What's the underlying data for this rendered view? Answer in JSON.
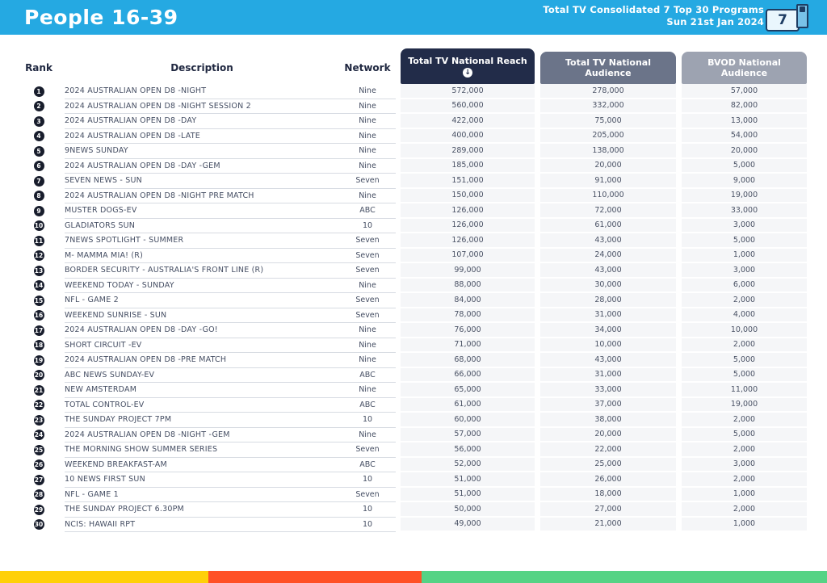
{
  "header": {
    "title": "People 16-39",
    "subtitle_line1": "Total TV Consolidated 7 Top 30 Programs",
    "subtitle_line2": "Sun 21st Jan 2024",
    "logo_number": "7",
    "background_color": "#25A9E2"
  },
  "table": {
    "columns": {
      "rank": "Rank",
      "description": "Description",
      "network": "Network",
      "reach": "Total TV National Reach",
      "audience": "Total TV National Audience",
      "bvod": "BVOD National Audience"
    },
    "header_colors": {
      "reach": "#222C49",
      "audience": "#6B7489",
      "bvod": "#9DA3B1"
    },
    "icons": {
      "sort_descending": "↓"
    },
    "rows": [
      {
        "rank": "1",
        "description": "2024 AUSTRALIAN OPEN D8 -NIGHT",
        "network": "Nine",
        "reach": "572,000",
        "audience": "278,000",
        "bvod": "57,000"
      },
      {
        "rank": "2",
        "description": "2024 AUSTRALIAN OPEN D8 -NIGHT SESSION 2",
        "network": "Nine",
        "reach": "560,000",
        "audience": "332,000",
        "bvod": "82,000"
      },
      {
        "rank": "3",
        "description": "2024 AUSTRALIAN OPEN D8 -DAY",
        "network": "Nine",
        "reach": "422,000",
        "audience": "75,000",
        "bvod": "13,000"
      },
      {
        "rank": "4",
        "description": "2024 AUSTRALIAN OPEN D8 -LATE",
        "network": "Nine",
        "reach": "400,000",
        "audience": "205,000",
        "bvod": "54,000"
      },
      {
        "rank": "5",
        "description": "9NEWS SUNDAY",
        "network": "Nine",
        "reach": "289,000",
        "audience": "138,000",
        "bvod": "20,000"
      },
      {
        "rank": "6",
        "description": "2024 AUSTRALIAN OPEN D8 -DAY -GEM",
        "network": "Nine",
        "reach": "185,000",
        "audience": "20,000",
        "bvod": "5,000"
      },
      {
        "rank": "7",
        "description": "SEVEN NEWS - SUN",
        "network": "Seven",
        "reach": "151,000",
        "audience": "91,000",
        "bvod": "9,000"
      },
      {
        "rank": "8",
        "description": "2024 AUSTRALIAN OPEN D8 -NIGHT PRE MATCH",
        "network": "Nine",
        "reach": "150,000",
        "audience": "110,000",
        "bvod": "19,000"
      },
      {
        "rank": "9",
        "description": "MUSTER DOGS-EV",
        "network": "ABC",
        "reach": "126,000",
        "audience": "72,000",
        "bvod": "33,000"
      },
      {
        "rank": "10",
        "description": "GLADIATORS SUN",
        "network": "10",
        "reach": "126,000",
        "audience": "61,000",
        "bvod": "3,000"
      },
      {
        "rank": "11",
        "description": "7NEWS SPOTLIGHT - SUMMER",
        "network": "Seven",
        "reach": "126,000",
        "audience": "43,000",
        "bvod": "5,000"
      },
      {
        "rank": "12",
        "description": "M- MAMMA MIA! (R)",
        "network": "Seven",
        "reach": "107,000",
        "audience": "24,000",
        "bvod": "1,000"
      },
      {
        "rank": "13",
        "description": "BORDER SECURITY - AUSTRALIA'S FRONT LINE (R)",
        "network": "Seven",
        "reach": "99,000",
        "audience": "43,000",
        "bvod": "3,000"
      },
      {
        "rank": "14",
        "description": "WEEKEND TODAY - SUNDAY",
        "network": "Nine",
        "reach": "88,000",
        "audience": "30,000",
        "bvod": "6,000"
      },
      {
        "rank": "15",
        "description": "NFL - GAME 2",
        "network": "Seven",
        "reach": "84,000",
        "audience": "28,000",
        "bvod": "2,000"
      },
      {
        "rank": "16",
        "description": "WEEKEND SUNRISE - SUN",
        "network": "Seven",
        "reach": "78,000",
        "audience": "31,000",
        "bvod": "4,000"
      },
      {
        "rank": "17",
        "description": "2024 AUSTRALIAN OPEN D8 -DAY -GO!",
        "network": "Nine",
        "reach": "76,000",
        "audience": "34,000",
        "bvod": "10,000"
      },
      {
        "rank": "18",
        "description": "SHORT CIRCUIT -EV",
        "network": "Nine",
        "reach": "71,000",
        "audience": "10,000",
        "bvod": "2,000"
      },
      {
        "rank": "19",
        "description": "2024 AUSTRALIAN OPEN D8 -PRE MATCH",
        "network": "Nine",
        "reach": "68,000",
        "audience": "43,000",
        "bvod": "5,000"
      },
      {
        "rank": "20",
        "description": "ABC NEWS SUNDAY-EV",
        "network": "ABC",
        "reach": "66,000",
        "audience": "31,000",
        "bvod": "5,000"
      },
      {
        "rank": "21",
        "description": "NEW AMSTERDAM",
        "network": "Nine",
        "reach": "65,000",
        "audience": "33,000",
        "bvod": "11,000"
      },
      {
        "rank": "22",
        "description": "TOTAL CONTROL-EV",
        "network": "ABC",
        "reach": "61,000",
        "audience": "37,000",
        "bvod": "19,000"
      },
      {
        "rank": "23",
        "description": "THE SUNDAY PROJECT 7PM",
        "network": "10",
        "reach": "60,000",
        "audience": "38,000",
        "bvod": "2,000"
      },
      {
        "rank": "24",
        "description": "2024 AUSTRALIAN OPEN D8 -NIGHT -GEM",
        "network": "Nine",
        "reach": "57,000",
        "audience": "20,000",
        "bvod": "5,000"
      },
      {
        "rank": "25",
        "description": "THE MORNING SHOW SUMMER SERIES",
        "network": "Seven",
        "reach": "56,000",
        "audience": "22,000",
        "bvod": "2,000"
      },
      {
        "rank": "26",
        "description": "WEEKEND BREAKFAST-AM",
        "network": "ABC",
        "reach": "52,000",
        "audience": "25,000",
        "bvod": "3,000"
      },
      {
        "rank": "27",
        "description": "10 NEWS FIRST SUN",
        "network": "10",
        "reach": "51,000",
        "audience": "26,000",
        "bvod": "2,000"
      },
      {
        "rank": "28",
        "description": "NFL - GAME 1",
        "network": "Seven",
        "reach": "51,000",
        "audience": "18,000",
        "bvod": "1,000"
      },
      {
        "rank": "29",
        "description": "THE SUNDAY PROJECT 6.30PM",
        "network": "10",
        "reach": "50,000",
        "audience": "27,000",
        "bvod": "2,000"
      },
      {
        "rank": "30",
        "description": "NCIS: HAWAII RPT",
        "network": "10",
        "reach": "49,000",
        "audience": "21,000",
        "bvod": "1,000"
      }
    ]
  },
  "footer": {
    "stripe_colors": [
      "#FFD008",
      "#FF5126",
      "#55D385"
    ]
  }
}
